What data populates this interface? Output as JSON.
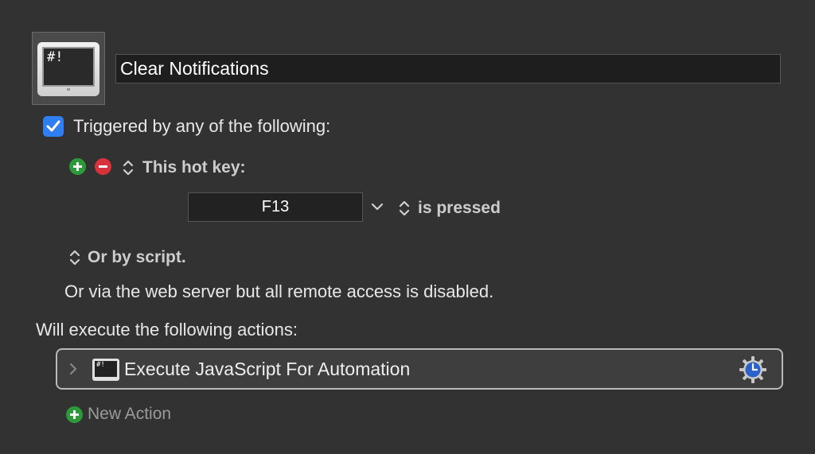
{
  "macro": {
    "icon_name": "terminal-script-icon",
    "icon_text": "#!",
    "name": "Clear Notifications"
  },
  "trigger": {
    "checked": true,
    "label": "Triggered by any of the following:",
    "hotkey_section_label": "This hot key:",
    "hotkey_value": "F13",
    "hotkey_condition": "is pressed",
    "script_label": "Or by script.",
    "web_server_note": "Or via the web server but all remote access is disabled."
  },
  "actions": {
    "header": "Will execute the following actions:",
    "items": [
      {
        "icon_text": "#!",
        "label": "Execute JavaScript For Automation"
      }
    ],
    "new_action_label": "New Action"
  },
  "colors": {
    "background": "#323232",
    "checkbox_blue": "#2f7ef2",
    "add_green": "#2d9a3a",
    "remove_red": "#d8323c",
    "gear_blue": "#2a62c9"
  }
}
